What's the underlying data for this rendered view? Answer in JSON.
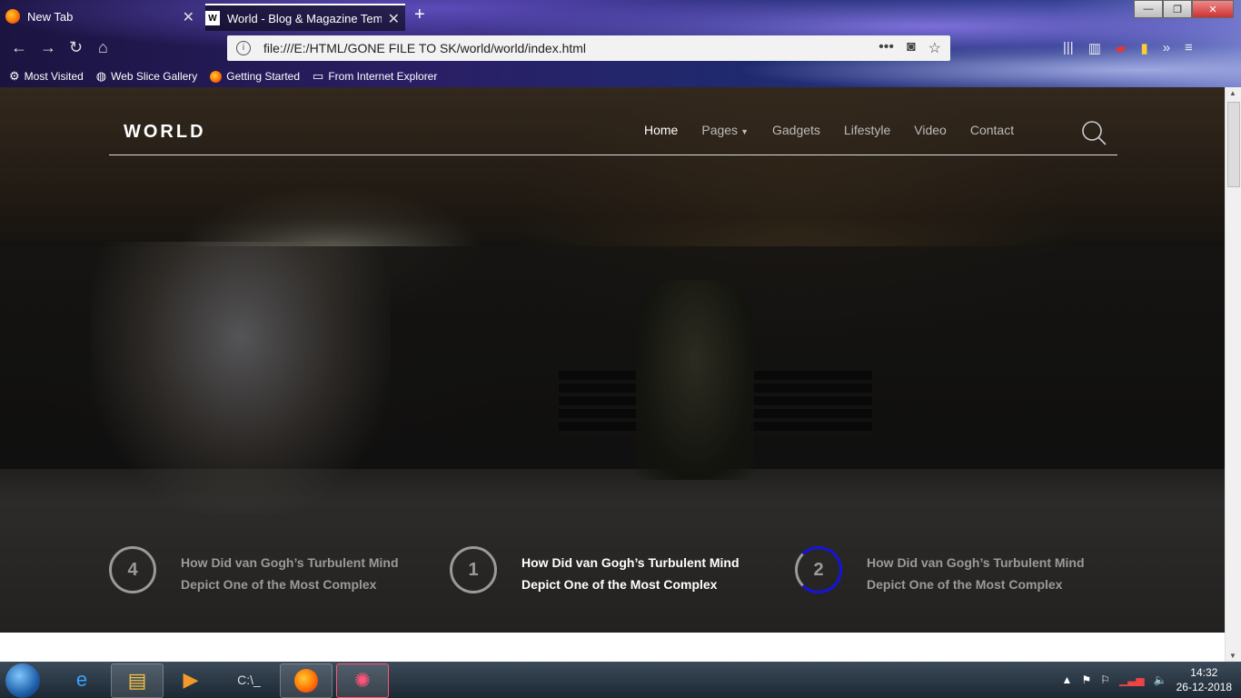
{
  "browser": {
    "tabs": [
      {
        "label": "New Tab",
        "active": false
      },
      {
        "label": "World - Blog & Magazine Tem",
        "active": true
      }
    ],
    "url": "file:///E:/HTML/GONE FILE TO SK/world/world/index.html",
    "window_buttons": {
      "minimize": "—",
      "maximize": "❐",
      "close": "✕"
    },
    "bookmarks": [
      {
        "label": "Most Visited",
        "icon": "gear-icon"
      },
      {
        "label": "Web Slice Gallery",
        "icon": "globe-icon"
      },
      {
        "label": "Getting Started",
        "icon": "firefox-icon"
      },
      {
        "label": "From Internet Explorer",
        "icon": "folder-icon"
      }
    ]
  },
  "site": {
    "logo": "WORLD",
    "nav": [
      {
        "label": "Home",
        "active": true
      },
      {
        "label": "Pages",
        "has_dropdown": true
      },
      {
        "label": "Gadgets"
      },
      {
        "label": "Lifestyle"
      },
      {
        "label": "Video"
      },
      {
        "label": "Contact"
      }
    ],
    "features": [
      {
        "number": "4",
        "line1": "How Did van Gogh’s Turbulent Mind",
        "line2": "Depict One of the Most Complex",
        "active": false
      },
      {
        "number": "1",
        "line1": "How Did van Gogh’s Turbulent Mind",
        "line2": "Depict One of the Most Complex",
        "active": true
      },
      {
        "number": "2",
        "line1": "How Did van Gogh’s Turbulent Mind",
        "line2": "Depict One of the Most Complex",
        "active": false,
        "progress_color": "#1414e0"
      }
    ]
  },
  "taskbar": {
    "time": "14:32",
    "date": "26-12-2018"
  }
}
